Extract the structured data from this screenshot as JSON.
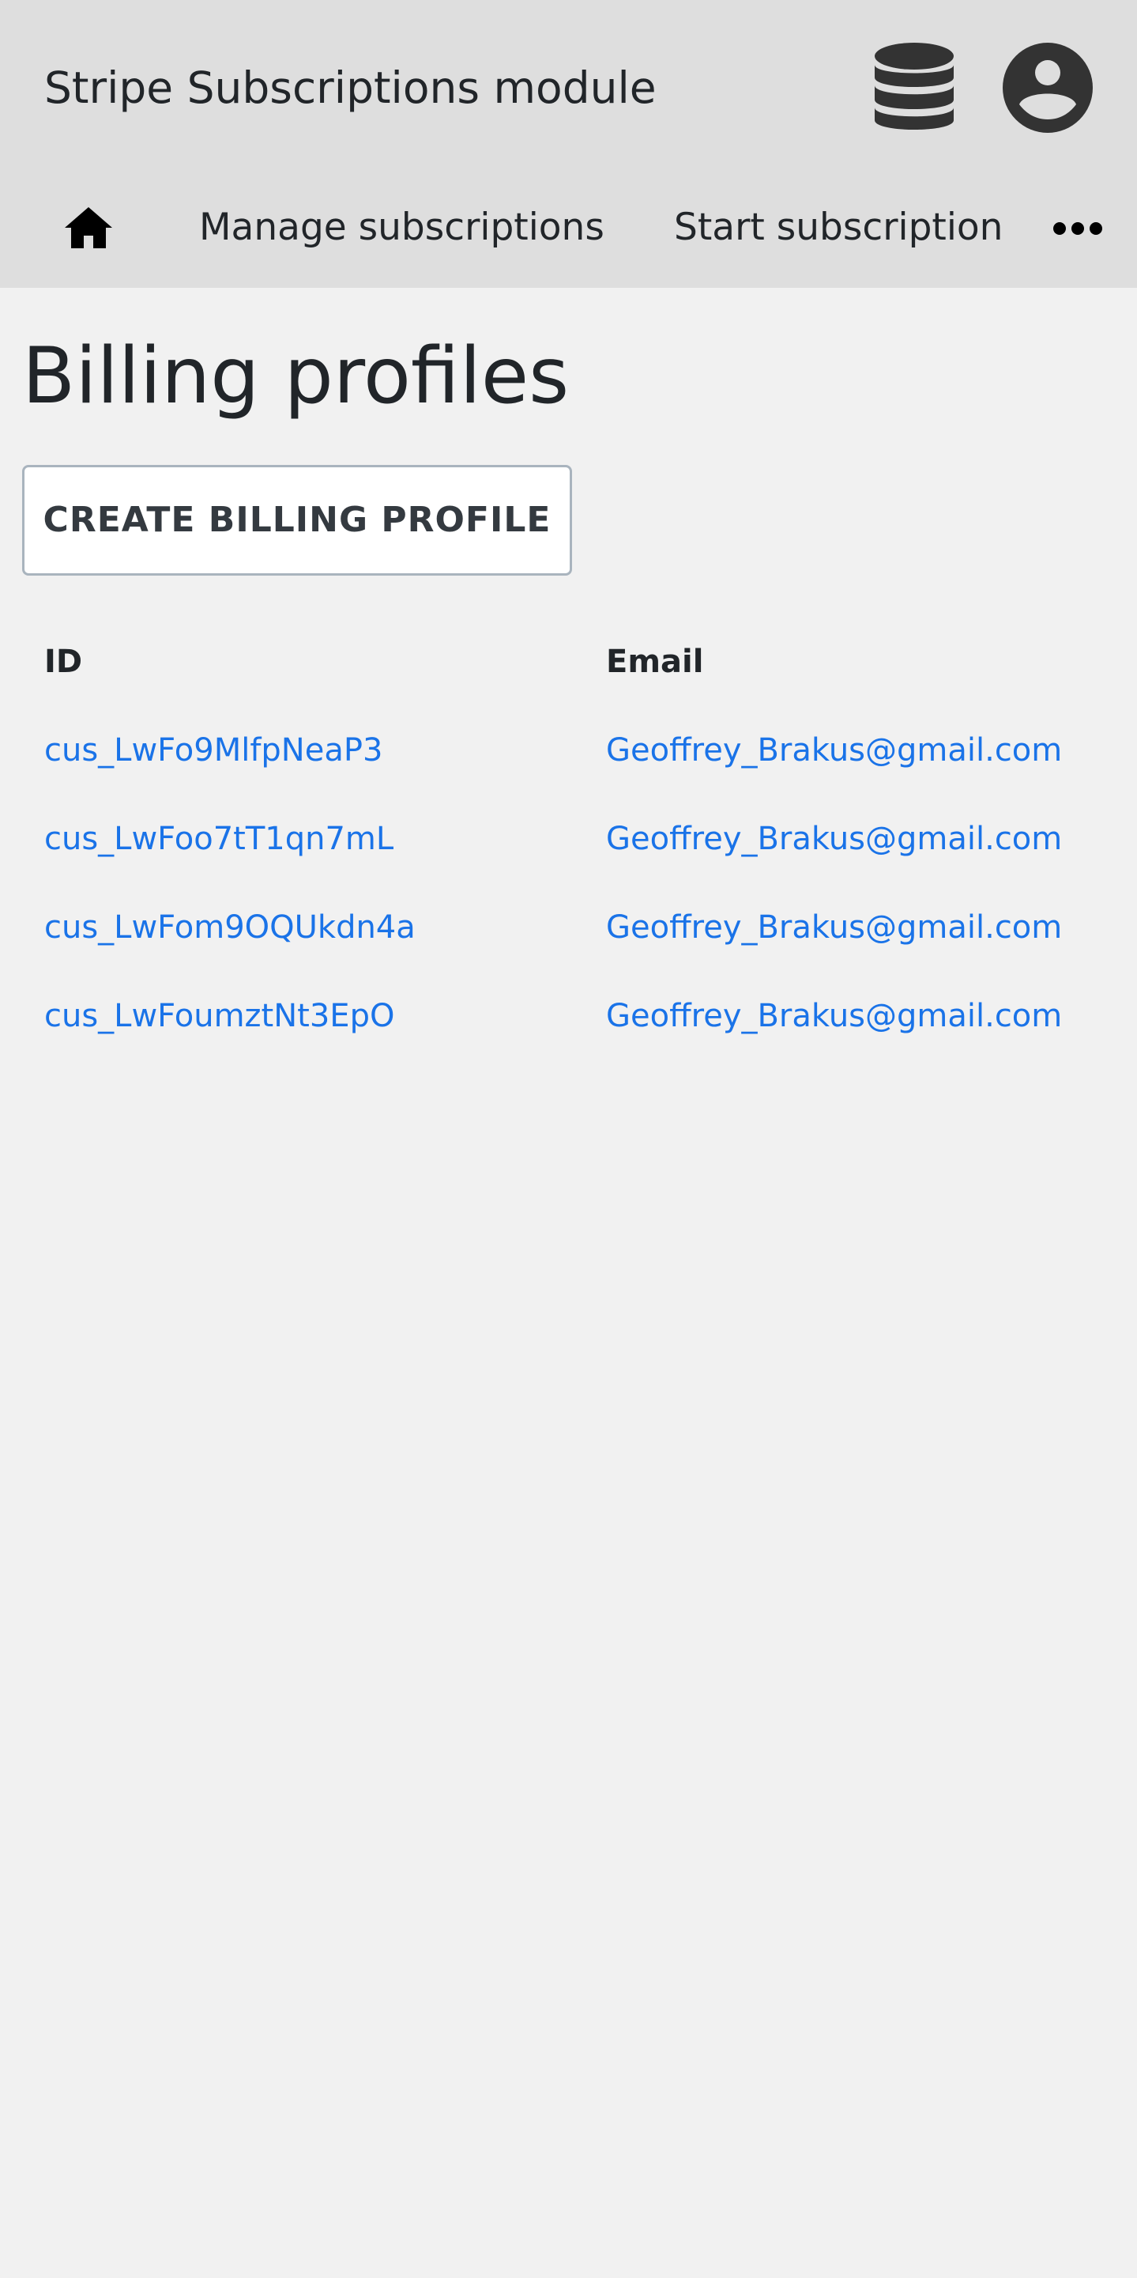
{
  "header": {
    "title": "Stripe Subscriptions module",
    "icons": {
      "database": "database-icon",
      "account": "account-circle-icon"
    }
  },
  "nav": {
    "home_icon": "home-icon",
    "items": [
      {
        "label": "Manage subscriptions"
      },
      {
        "label": "Start subscription"
      }
    ],
    "more_icon": "more-horizontal-icon"
  },
  "main": {
    "title": "Billing profiles",
    "create_button": "CREATE BILLING PROFILE",
    "table": {
      "columns": [
        "ID",
        "Email"
      ],
      "rows": [
        {
          "id": "cus_LwFo9MlfpNeaP3",
          "email": "Geoffrey_Brakus@gmail.com"
        },
        {
          "id": "cus_LwFoo7tT1qn7mL",
          "email": "Geoffrey_Brakus@gmail.com"
        },
        {
          "id": "cus_LwFom9OQUkdn4a",
          "email": "Geoffrey_Brakus@gmail.com"
        },
        {
          "id": "cus_LwFoumztNt3EpO",
          "email": "Geoffrey_Brakus@gmail.com"
        }
      ]
    }
  },
  "colors": {
    "header_bg": "#dedede",
    "page_bg": "#f1f1f1",
    "link": "#1a73e8",
    "text": "#212529",
    "icon": "#333333"
  }
}
